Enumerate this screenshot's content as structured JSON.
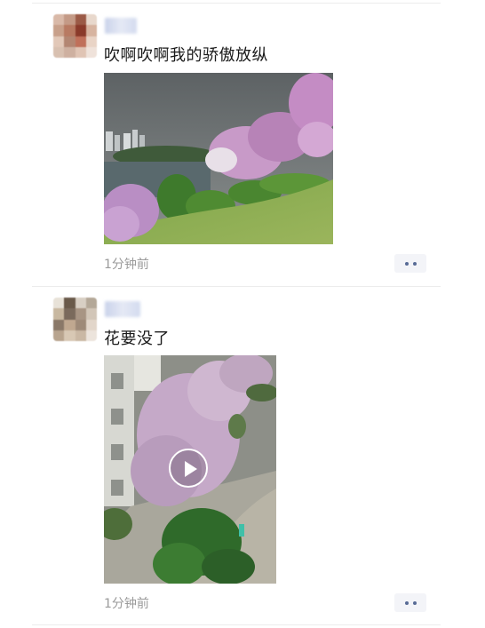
{
  "posts": [
    {
      "text": "吹啊吹啊我的骄傲放纵",
      "time": "1分钟前",
      "media_type": "photo",
      "icon": "more-dots-icon"
    },
    {
      "text": "花要没了",
      "time": "1分钟前",
      "media_type": "video",
      "icon": "more-dots-icon",
      "play_icon": "play-icon"
    }
  ],
  "colors": {
    "link_blue": "#576b95",
    "timestamp_gray": "#9a9a9a",
    "divider": "#ececec"
  }
}
